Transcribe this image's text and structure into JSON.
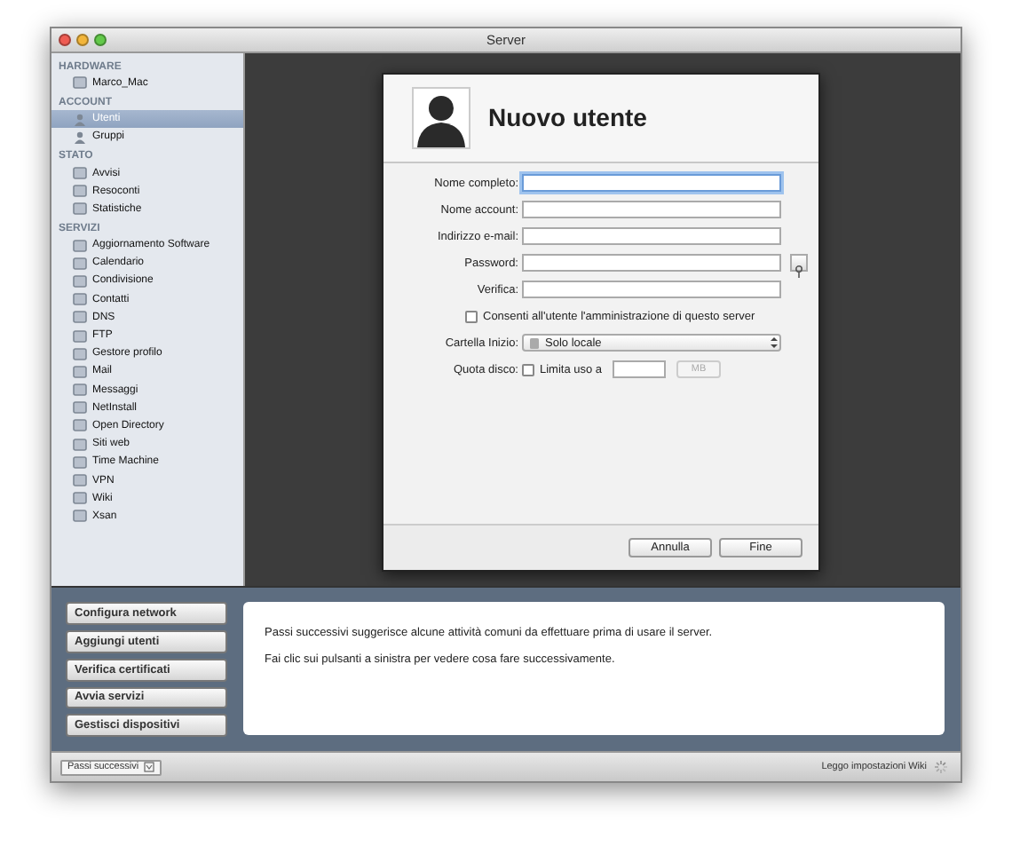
{
  "window": {
    "title": "Server"
  },
  "sidebar": {
    "sections": [
      {
        "title": "HARDWARE",
        "items": [
          {
            "label": "Marco_Mac",
            "selected": false
          }
        ]
      },
      {
        "title": "ACCOUNT",
        "items": [
          {
            "label": "Utenti",
            "selected": true
          },
          {
            "label": "Gruppi",
            "selected": false
          }
        ]
      },
      {
        "title": "STATO",
        "items": [
          {
            "label": "Avvisi",
            "selected": false
          },
          {
            "label": "Resoconti",
            "selected": false
          },
          {
            "label": "Statistiche",
            "selected": false
          }
        ]
      },
      {
        "title": "SERVIZI",
        "items": [
          {
            "label": "Aggiornamento Software",
            "selected": false
          },
          {
            "label": "Calendario",
            "selected": false
          },
          {
            "label": "Condivisione",
            "selected": false
          },
          {
            "label": "Contatti",
            "selected": false
          },
          {
            "label": "DNS",
            "selected": false
          },
          {
            "label": "FTP",
            "selected": false
          },
          {
            "label": "Gestore profilo",
            "selected": false
          },
          {
            "label": "Mail",
            "selected": false
          },
          {
            "label": "Messaggi",
            "selected": false
          },
          {
            "label": "NetInstall",
            "selected": false
          },
          {
            "label": "Open Directory",
            "selected": false
          },
          {
            "label": "Siti web",
            "selected": false
          },
          {
            "label": "Time Machine",
            "selected": false
          },
          {
            "label": "VPN",
            "selected": false
          },
          {
            "label": "Wiki",
            "selected": false
          },
          {
            "label": "Xsan",
            "selected": false
          }
        ]
      }
    ]
  },
  "dialog": {
    "title": "Nuovo utente",
    "fields": [
      {
        "label": "Nome completo:",
        "kind": "text",
        "focused": true
      },
      {
        "label": "Nome account:",
        "kind": "text",
        "focused": false
      },
      {
        "label": "Indirizzo e-mail:",
        "kind": "text",
        "focused": false
      },
      {
        "label": "Password:",
        "kind": "password",
        "focused": false
      },
      {
        "label": "Verifica:",
        "kind": "text",
        "focused": false
      }
    ],
    "admin_checkbox": {
      "label": "Consenti all'utente l'amministrazione di questo server",
      "checked": false
    },
    "home_folder": {
      "label": "Cartella Inizio:",
      "value": "Solo locale"
    },
    "quota": {
      "label": "Quota disco:",
      "checkbox_label": "Limita uso a",
      "checked": false,
      "unit": "MB"
    },
    "buttons": [
      "Annulla",
      "Fine"
    ]
  },
  "next_steps": {
    "buttons": [
      "Configura network",
      "Aggiungi utenti",
      "Verifica certificati",
      "Avvia servizi",
      "Gestisci dispositivi"
    ],
    "messages": [
      "Passi successivi suggerisce alcune attività comuni da effettuare prima di usare il server.",
      "Fai clic sui pulsanti a sinistra per vedere cosa fare successivamente."
    ]
  },
  "status_bar": {
    "button": "Passi successivi",
    "text": "Leggo impostazioni Wiki"
  }
}
